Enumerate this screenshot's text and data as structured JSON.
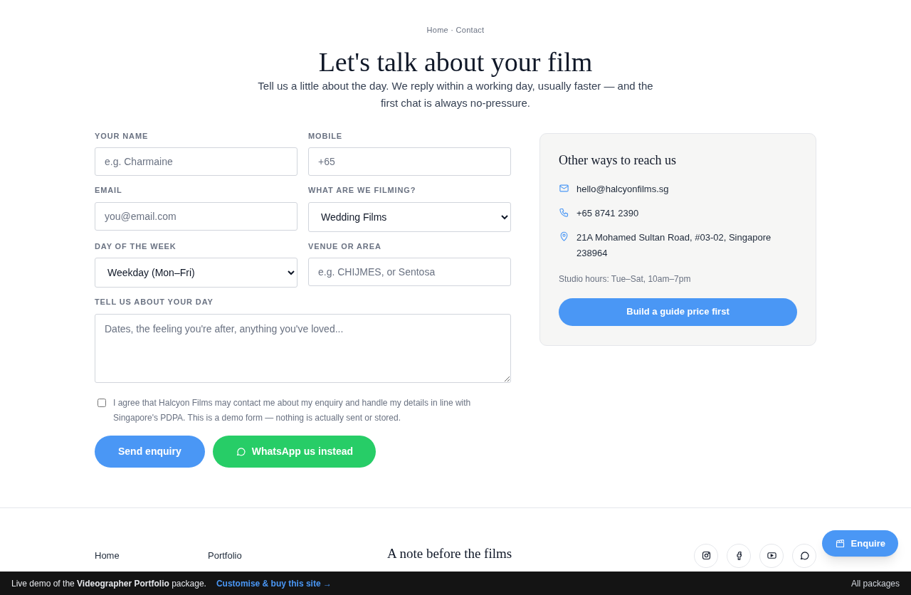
{
  "breadcrumb": "Home · Contact",
  "heading": "Let's talk about your film",
  "intro": "Tell us a little about the day. We reply within a working day, usually faster — and the first chat is always no-pressure.",
  "form": {
    "fields": [
      {
        "kind": "input",
        "label": "YOUR NAME",
        "placeholder": "e.g. Charmaine"
      },
      {
        "kind": "input",
        "label": "MOBILE",
        "placeholder": "+65"
      },
      {
        "kind": "input",
        "label": "EMAIL",
        "placeholder": "you@email.com"
      },
      {
        "kind": "select",
        "label": "WHAT ARE WE FILMING?",
        "value": "Wedding Films"
      },
      {
        "kind": "select",
        "label": "DAY OF THE WEEK",
        "value": "Weekday (Mon–Fri)"
      },
      {
        "kind": "input",
        "label": "VENUE OR AREA",
        "placeholder": "e.g. CHIJMES, or Sentosa"
      },
      {
        "kind": "textarea",
        "label": "TELL US ABOUT YOUR DAY",
        "placeholder": "Dates, the feeling you're after, anything you've loved..."
      }
    ],
    "consent": {
      "checked": false,
      "text": "I agree that Halcyon Films may contact me about my enquiry and handle my details in line with Singapore's PDPA. This is a demo form — nothing is actually sent or stored."
    },
    "buttons": [
      {
        "kind": "primary",
        "label": "Send enquiry"
      },
      {
        "kind": "whatsapp",
        "label": "WhatsApp us instead"
      }
    ]
  },
  "contact_card": {
    "title": "Other ways to reach us",
    "items": [
      {
        "kind": "email",
        "text": "hello@halcyonfilms.sg"
      },
      {
        "kind": "phone",
        "text": "+65 8741 2390"
      },
      {
        "kind": "location",
        "text": "21A Mohamed Sultan Road, #03-02, Singapore 238964"
      }
    ],
    "hours": "Studio hours: Tue–Sat, 10am–7pm",
    "button": "Build a guide price first"
  },
  "footer": {
    "links_1": [
      "Home"
    ],
    "links_2": [
      "Portfolio"
    ],
    "note_title": "A note before the films",
    "social": [
      {
        "kind": "instagram"
      },
      {
        "kind": "facebook"
      },
      {
        "kind": "youtube"
      },
      {
        "kind": "chat"
      }
    ]
  },
  "enquire_button": "Enquire",
  "demo_bar": {
    "text": "Live demo of the **Videographer Portfolio** package.",
    "link": "Customise & buy this site →",
    "right_link": "All packages"
  }
}
